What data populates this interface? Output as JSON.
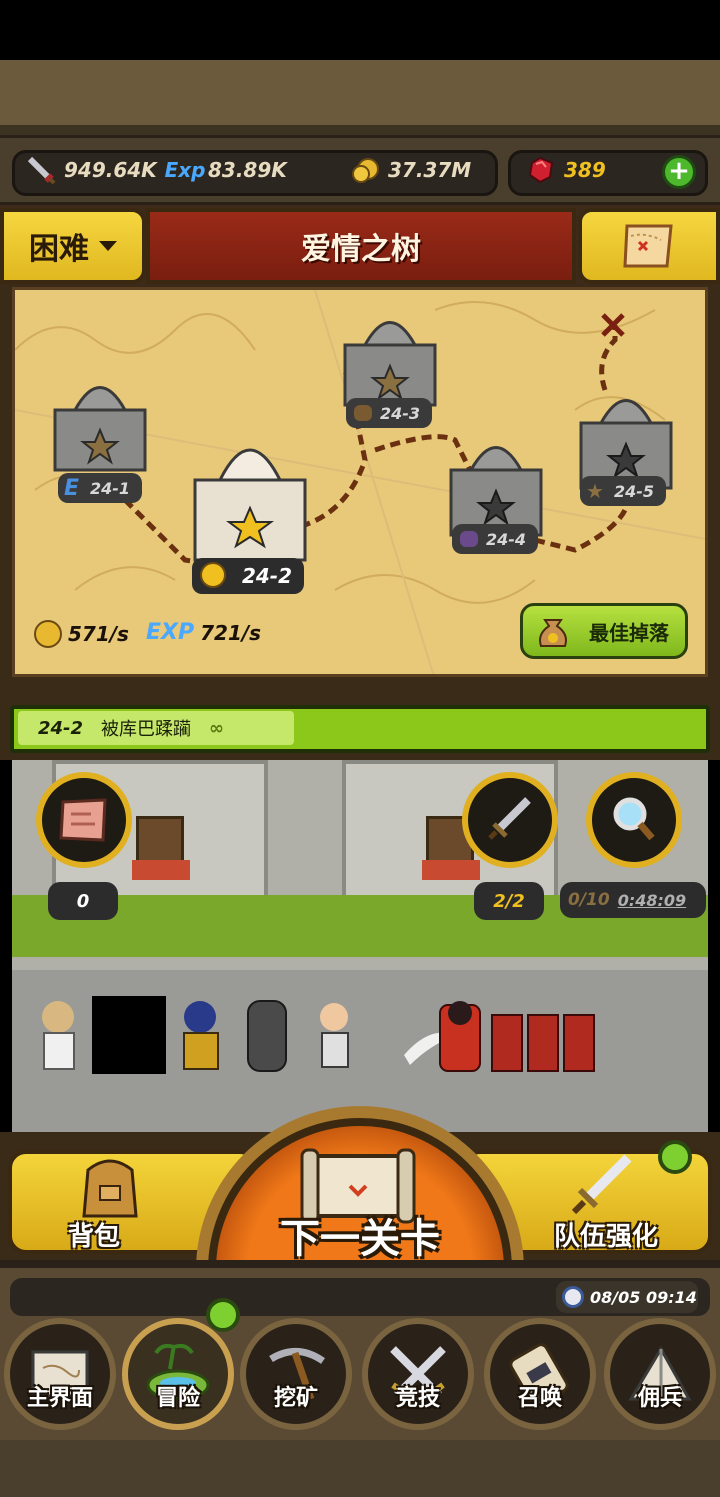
{
  "resources": {
    "attack": "949.64K",
    "exp_icon": "Exp",
    "exp": "83.89K",
    "gold": "37.37M",
    "gems": "389"
  },
  "header": {
    "difficulty": "困难",
    "area_title": "爱情之树"
  },
  "map": {
    "nodes": [
      {
        "label": "24-1",
        "badge": "E"
      },
      {
        "label": "24-2",
        "badge": "coin"
      },
      {
        "label": "24-3",
        "badge": "bag"
      },
      {
        "label": "24-4",
        "badge": "pouch"
      },
      {
        "label": "24-5",
        "badge": "star"
      }
    ],
    "gold_rate": "571/s",
    "exp_label": "EXP",
    "exp_rate": "721/s",
    "best_drop_label": "最佳掉落"
  },
  "stage": {
    "number": "24-2",
    "name": "被库巴蹂躏",
    "repeat_symbol": "∞"
  },
  "battle": {
    "map_count": "0",
    "sword_count": "2/2",
    "search_count": "0/10",
    "search_timer": "0:48:09"
  },
  "actions": {
    "bag_label": "背包",
    "next_stage_label": "下一关卡",
    "team_upgrade_label": "队伍强化"
  },
  "status": {
    "datetime": "08/05 09:14"
  },
  "nav": {
    "items": [
      {
        "label": "主界面",
        "icon": "scroll-map-icon"
      },
      {
        "label": "冒险",
        "icon": "island-icon"
      },
      {
        "label": "挖矿",
        "icon": "pickaxe-icon"
      },
      {
        "label": "竞技",
        "icon": "crossed-swords-icon"
      },
      {
        "label": "召唤",
        "icon": "summon-scroll-icon"
      },
      {
        "label": "佣兵",
        "icon": "tent-icon"
      }
    ]
  },
  "colors": {
    "accent_gold": "#e0b020",
    "title_red": "#8a2414",
    "stage_green": "#8cc81a",
    "next_orange": "#f07818"
  }
}
